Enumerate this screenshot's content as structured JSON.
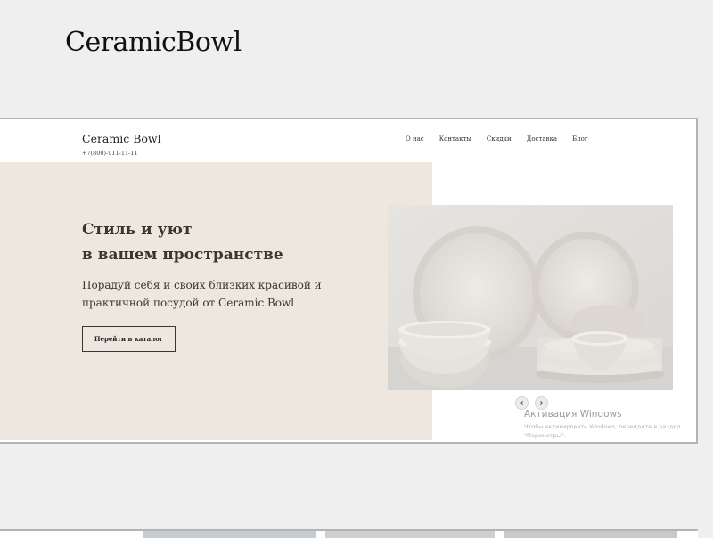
{
  "page": {
    "title": "CeramicBowl"
  },
  "site": {
    "brand": "Ceramic Bowl",
    "phone": "+7(800)-911-11-11",
    "nav": [
      "О нас",
      "Контакты",
      "Скидки",
      "Доставка",
      "Блог"
    ]
  },
  "hero": {
    "title_line1": "Стиль и уют",
    "title_line2": "в вашем пространстве",
    "subtitle_line1": "Порадуй себя и своих близких красивой и",
    "subtitle_line2": "практичной посудой от Ceramic Bowl",
    "cta_label": "Перейти в каталог"
  },
  "slider": {
    "prev_icon": "chevron-left-icon",
    "next_icon": "chevron-right-icon"
  },
  "windows_activation": {
    "title": "Активация Windows",
    "text": "Чтобы активировать Windows, перейдите в раздел \"Параметры\"."
  },
  "colors": {
    "page_bg": "#efefef",
    "hero_bg": "#ede7e0",
    "text_dark": "#3a3530",
    "frame_border": "#b4b4b4"
  }
}
